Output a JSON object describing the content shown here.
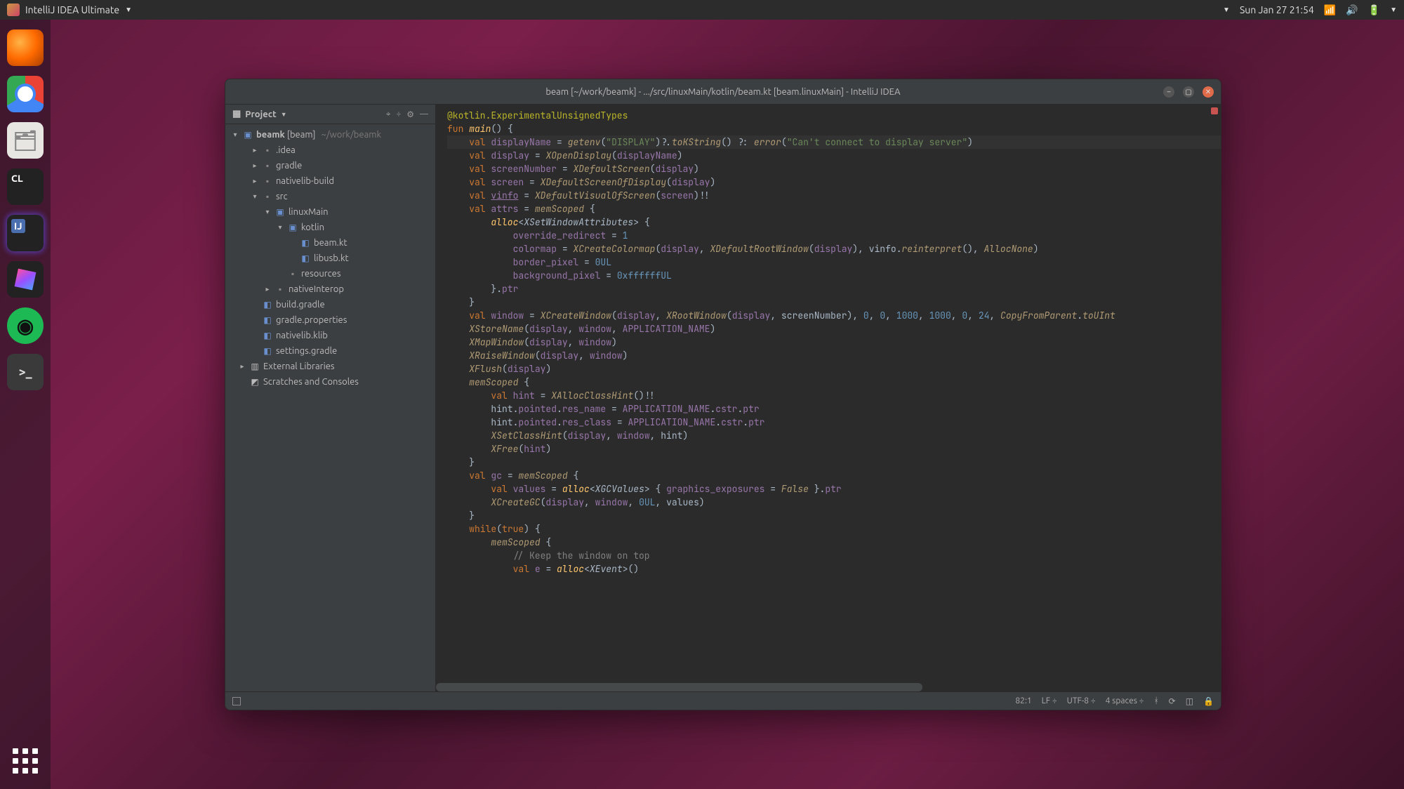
{
  "menubar": {
    "app_label": "IntelliJ IDEA Ultimate",
    "datetime": "Sun Jan 27  21:54"
  },
  "dock": {
    "items": [
      "firefox",
      "chrome",
      "files",
      "clion",
      "intellij",
      "toolbox",
      "spotify",
      "terminal"
    ]
  },
  "ide": {
    "title": "beam [~/work/beamk] - .../src/linuxMain/kotlin/beam.kt [beam.linuxMain] - IntelliJ IDEA",
    "project_panel": {
      "title": "Project",
      "root": {
        "name": "beamk",
        "tag": "[beam]",
        "path": "~/work/beamk"
      },
      "tree": [
        {
          "name": ".idea",
          "lvl": 1,
          "kind": "folder",
          "chev": "▸"
        },
        {
          "name": "gradle",
          "lvl": 1,
          "kind": "folder",
          "chev": "▸"
        },
        {
          "name": "nativelib-build",
          "lvl": 1,
          "kind": "folder",
          "chev": "▸"
        },
        {
          "name": "src",
          "lvl": 1,
          "kind": "folder",
          "chev": "▾"
        },
        {
          "name": "linuxMain",
          "lvl": 2,
          "kind": "module",
          "chev": "▾"
        },
        {
          "name": "kotlin",
          "lvl": 3,
          "kind": "module",
          "chev": "▾"
        },
        {
          "name": "beam.kt",
          "lvl": 4,
          "kind": "file",
          "chev": ""
        },
        {
          "name": "libusb.kt",
          "lvl": 4,
          "kind": "file",
          "chev": ""
        },
        {
          "name": "resources",
          "lvl": 3,
          "kind": "folder",
          "chev": ""
        },
        {
          "name": "nativeInterop",
          "lvl": 2,
          "kind": "folder",
          "chev": "▸"
        },
        {
          "name": "build.gradle",
          "lvl": 1,
          "kind": "file",
          "chev": ""
        },
        {
          "name": "gradle.properties",
          "lvl": 1,
          "kind": "file",
          "chev": ""
        },
        {
          "name": "nativelib.klib",
          "lvl": 1,
          "kind": "file",
          "chev": ""
        },
        {
          "name": "settings.gradle",
          "lvl": 1,
          "kind": "file",
          "chev": ""
        },
        {
          "name": "External Libraries",
          "lvl": 0,
          "kind": "lib",
          "chev": "▸"
        },
        {
          "name": "Scratches and Consoles",
          "lvl": 0,
          "kind": "scratch",
          "chev": ""
        }
      ]
    },
    "editor": {
      "lines": [
        {
          "t": "@kotlin.ExperimentalUnsignedTypes",
          "cls": "ann"
        },
        {
          "raw": "<span class='kw'>fun</span> <span class='fn'>main</span>() {"
        },
        {
          "hl": true,
          "raw": "    <span class='kw'>val</span> <span class='id'>displayName</span> = <span class='fncall'>getenv</span>(<span class='str'>\"DISPLAY\"</span>)?.<span class='fncall'>toKString</span>() ?: <span class='fncall'>error</span>(<span class='str'>\"Can't connect to display server\"</span>)"
        },
        {
          "t": ""
        },
        {
          "raw": "    <span class='kw'>val</span> <span class='id'>display</span> = <span class='fncall'>XOpenDisplay</span>(<span class='id'>displayName</span>)"
        },
        {
          "raw": "    <span class='kw'>val</span> <span class='id'>screenNumber</span> = <span class='fncall'>XDefaultScreen</span>(<span class='id'>display</span>)"
        },
        {
          "raw": "    <span class='kw'>val</span> <span class='id'>screen</span> = <span class='fncall'>XDefaultScreenOfDisplay</span>(<span class='id'>display</span>)"
        },
        {
          "t": ""
        },
        {
          "raw": "    <span class='kw'>val</span> <span class='id underl'>vinfo</span> = <span class='fncall'>XDefaultVisualOfScreen</span>(<span class='id'>screen</span>)!!"
        },
        {
          "t": ""
        },
        {
          "raw": "    <span class='kw'>val</span> <span class='id'>attrs</span> = <span class='fncall'>memScoped</span> {"
        },
        {
          "raw": "        <span class='fn'>alloc</span>&lt;<span class='type'>XSetWindowAttributes</span>&gt; {"
        },
        {
          "raw": "            <span class='id'>override_redirect</span> = <span class='num'>1</span>"
        },
        {
          "raw": "            <span class='id'>colormap</span> = <span class='fncall'>XCreateColormap</span>(<span class='id'>display</span>, <span class='fncall'>XDefaultRootWindow</span>(<span class='id'>display</span>), vinfo.<span class='fncall'>reinterpret</span>(), <span class='fncall'>AllocNone</span>)"
        },
        {
          "raw": "            <span class='id'>border_pixel</span> = <span class='num'>0UL</span>"
        },
        {
          "raw": "            <span class='id'>background_pixel</span> = <span class='num'>0xffffffUL</span>"
        },
        {
          "raw": "        }.<span class='id'>ptr</span>"
        },
        {
          "t": "    }"
        },
        {
          "t": ""
        },
        {
          "raw": "    <span class='kw'>val</span> <span class='id'>window</span> = <span class='fncall'>XCreateWindow</span>(<span class='id'>display</span>, <span class='fncall'>XRootWindow</span>(<span class='id'>display</span>, screenNumber), <span class='num'>0</span>, <span class='num'>0</span>, <span class='num'>1000</span>, <span class='num'>1000</span>, <span class='num'>0</span>, <span class='num'>24</span>, <span class='fncall'>CopyFromParent</span>.<span class='fncall'>toUInt</span>"
        },
        {
          "raw": "    <span class='fncall'>XStoreName</span>(<span class='id'>display</span>, <span class='id'>window</span>, <span class='id'>APPLICATION_NAME</span>)"
        },
        {
          "t": ""
        },
        {
          "raw": "    <span class='fncall'>XMapWindow</span>(<span class='id'>display</span>, <span class='id'>window</span>)"
        },
        {
          "raw": "    <span class='fncall'>XRaiseWindow</span>(<span class='id'>display</span>, <span class='id'>window</span>)"
        },
        {
          "raw": "    <span class='fncall'>XFlush</span>(<span class='id'>display</span>)"
        },
        {
          "t": ""
        },
        {
          "raw": "    <span class='fncall'>memScoped</span> {"
        },
        {
          "raw": "        <span class='kw'>val</span> <span class='id'>hint</span> = <span class='fncall'>XAllocClassHint</span>()!!"
        },
        {
          "raw": "        hint.<span class='id'>pointed</span>.<span class='id'>res_name</span> = <span class='id'>APPLICATION_NAME</span>.<span class='id'>cstr</span>.<span class='id'>ptr</span>"
        },
        {
          "raw": "        hint.<span class='id'>pointed</span>.<span class='id'>res_class</span> = <span class='id'>APPLICATION_NAME</span>.<span class='id'>cstr</span>.<span class='id'>ptr</span>"
        },
        {
          "raw": "        <span class='fncall'>XSetClassHint</span>(<span class='id'>display</span>, <span class='id'>window</span>, hint)"
        },
        {
          "raw": "        <span class='fncall'>XFree</span>(<span class='id'>hint</span>)"
        },
        {
          "t": "    }"
        },
        {
          "t": ""
        },
        {
          "raw": "    <span class='kw'>val</span> <span class='id'>gc</span> = <span class='fncall'>memScoped</span> {"
        },
        {
          "raw": "        <span class='kw'>val</span> <span class='id'>values</span> = <span class='fn'>alloc</span>&lt;<span class='type'>XGCValues</span>&gt; { <span class='id'>graphics_exposures</span> = <span class='fncall'>False</span> }.<span class='id'>ptr</span>"
        },
        {
          "raw": "        <span class='fncall'>XCreateGC</span>(<span class='id'>display</span>, <span class='id'>window</span>, <span class='num'>0UL</span>, values)"
        },
        {
          "t": "    }"
        },
        {
          "raw": "    <span class='kw'>while</span>(<span class='kw'>true</span>) {"
        },
        {
          "raw": "        <span class='fncall'>memScoped</span> {"
        },
        {
          "raw": "            <span class='cmt'>// Keep the window on top</span>"
        },
        {
          "raw": "            <span class='kw'>val</span> <span class='id'>e</span> = <span class='fn'>alloc</span>&lt;<span class='type'>XEvent</span>&gt;()"
        }
      ]
    },
    "statusbar": {
      "pos": "82:1",
      "sep": "LF",
      "enc": "UTF-8",
      "indent": "4 spaces"
    }
  }
}
